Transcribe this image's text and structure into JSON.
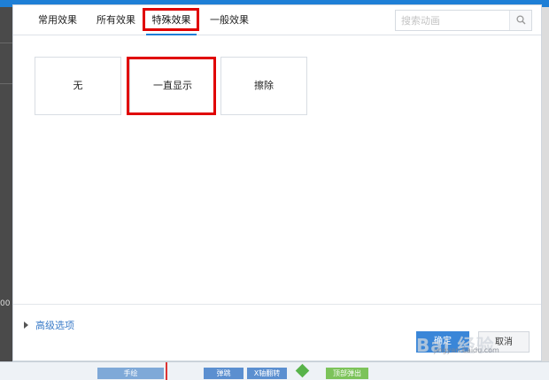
{
  "dialog": {
    "tabs": [
      {
        "label": "常用效果"
      },
      {
        "label": "所有效果"
      },
      {
        "label": "特殊效果"
      },
      {
        "label": "一般效果"
      }
    ],
    "search": {
      "placeholder": "搜索动画",
      "icon": "search-icon"
    },
    "effects": [
      {
        "label": "无"
      },
      {
        "label": "一直显示"
      },
      {
        "label": "擦除"
      }
    ],
    "advanced_label": "高级选项",
    "ok_label": "确定",
    "cancel_label": "取消"
  },
  "background": {
    "left_number": "00",
    "timeline": [
      {
        "label": "手绘"
      },
      {
        "label": "弹跳"
      },
      {
        "label": "X轴翻转"
      },
      {
        "label": "顶部弹出"
      }
    ]
  },
  "watermark": {
    "main": "Bai 经验",
    "sub": "jingyan.baidu.com"
  },
  "colors": {
    "accent": "#1e7fd6",
    "highlight": "#e00000",
    "link": "#3a7bc8"
  }
}
